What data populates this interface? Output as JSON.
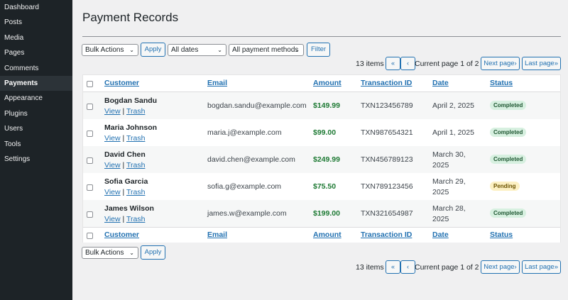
{
  "sidebar": {
    "items": [
      {
        "label": "Dashboard"
      },
      {
        "label": "Posts"
      },
      {
        "label": "Media"
      },
      {
        "label": "Pages"
      },
      {
        "label": "Comments"
      },
      {
        "label": "Payments",
        "active": true
      },
      {
        "label": "Appearance"
      },
      {
        "label": "Plugins"
      },
      {
        "label": "Users"
      },
      {
        "label": "Tools"
      },
      {
        "label": "Settings"
      }
    ]
  },
  "page": {
    "title": "Payment Records"
  },
  "filters": {
    "bulk_actions": "Bulk Actions",
    "apply": "Apply",
    "dates": "All dates",
    "methods": "All payment methods",
    "filter": "Filter"
  },
  "pagination": {
    "items": "13 items",
    "first": "«",
    "prev": "‹",
    "current": "Current page 1 of 2",
    "next": "Next page›",
    "last": "Last page»"
  },
  "table": {
    "headers": {
      "customer": "Customer",
      "email": "Email",
      "amount": "Amount",
      "transaction_id": "Transaction ID",
      "date": "Date",
      "status": "Status"
    },
    "actions": {
      "view": "View",
      "separator": "|",
      "trash": "Trash"
    },
    "rows": [
      {
        "customer": "Bogdan Sandu",
        "email": "bogdan.sandu@example.com",
        "amount": "$149.99",
        "txn": "TXN123456789",
        "date": "April 2, 2025",
        "status": "Completed"
      },
      {
        "customer": "Maria Johnson",
        "email": "maria.j@example.com",
        "amount": "$99.00",
        "txn": "TXN987654321",
        "date": "April 1, 2025",
        "status": "Completed"
      },
      {
        "customer": "David Chen",
        "email": "david.chen@example.com",
        "amount": "$249.99",
        "txn": "TXN456789123",
        "date": "March 30, 2025",
        "status": "Completed"
      },
      {
        "customer": "Sofia Garcia",
        "email": "sofia.g@example.com",
        "amount": "$75.50",
        "txn": "TXN789123456",
        "date": "March 29, 2025",
        "status": "Pending"
      },
      {
        "customer": "James Wilson",
        "email": "james.w@example.com",
        "amount": "$199.00",
        "txn": "TXN321654987",
        "date": "March 28, 2025",
        "status": "Completed"
      }
    ]
  },
  "colors": {
    "sidebar_bg": "#1d2327",
    "link": "#2271b1",
    "amount": "#1e7a34",
    "completed_bg": "#d7f0e0",
    "pending_bg": "#fcf0c3"
  }
}
